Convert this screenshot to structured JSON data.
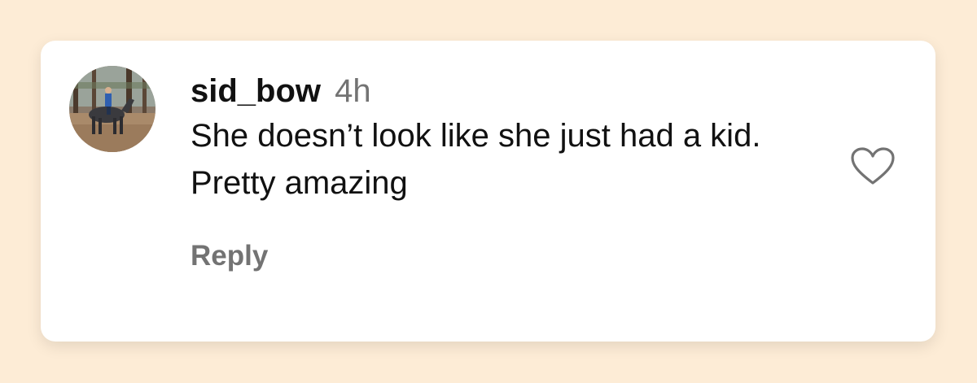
{
  "comment": {
    "username": "sid_bow",
    "timestamp": "4h",
    "text": "She doesn’t look like she just had a kid. Pretty amazing",
    "reply_label": "Reply",
    "avatar_icon": "user-avatar-horse-rider",
    "like_icon": "heart-outline-icon"
  },
  "colors": {
    "page_background": "#fdecd6",
    "card_background": "#ffffff",
    "primary_text": "#111111",
    "secondary_text": "#737373"
  }
}
